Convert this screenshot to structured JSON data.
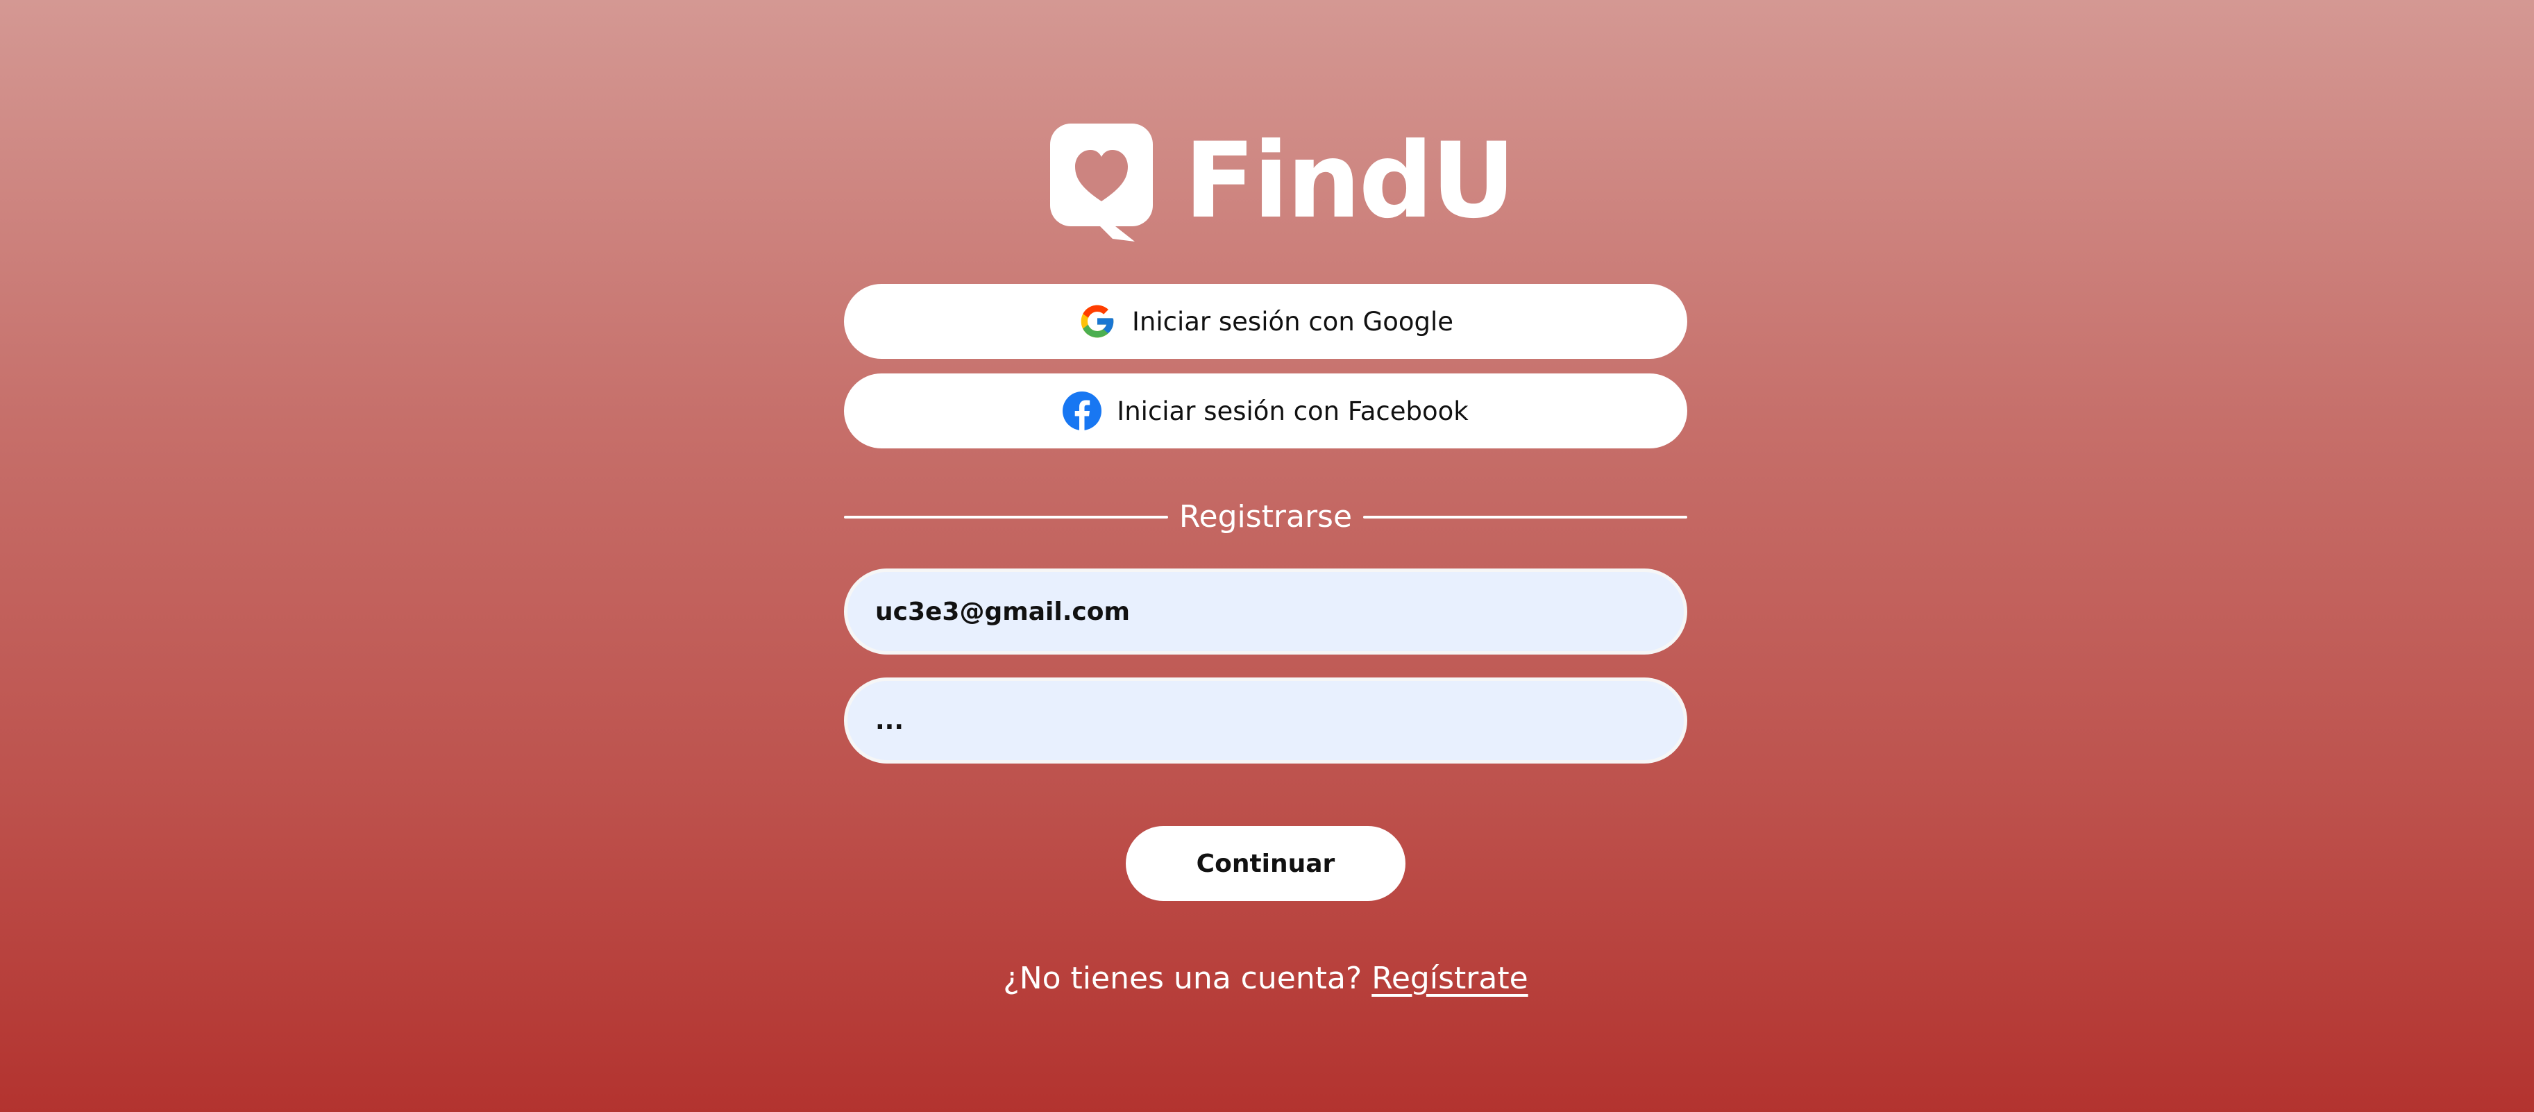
{
  "brand": {
    "name": "FindU",
    "logo_icon": "heart-chat-bubble-icon",
    "text_color": "#ffffff"
  },
  "theme": {
    "gradient_top": "#d49893",
    "gradient_bottom": "#b3332f",
    "input_background": "#e8f0fe",
    "button_background": "#ffffff",
    "facebook_blue": "#1877f2"
  },
  "social_login": {
    "google_label": "Iniciar sesión con Google",
    "google_icon": "google-icon",
    "facebook_label": "Iniciar sesión con Facebook",
    "facebook_icon": "facebook-icon"
  },
  "divider": {
    "label": "Registrarse"
  },
  "form": {
    "email_value": "uc3e3@gmail.com",
    "password_value": "...",
    "continue_label": "Continuar"
  },
  "footer": {
    "prompt": "¿No tienes una cuenta?",
    "link_label": "Regístrate"
  }
}
